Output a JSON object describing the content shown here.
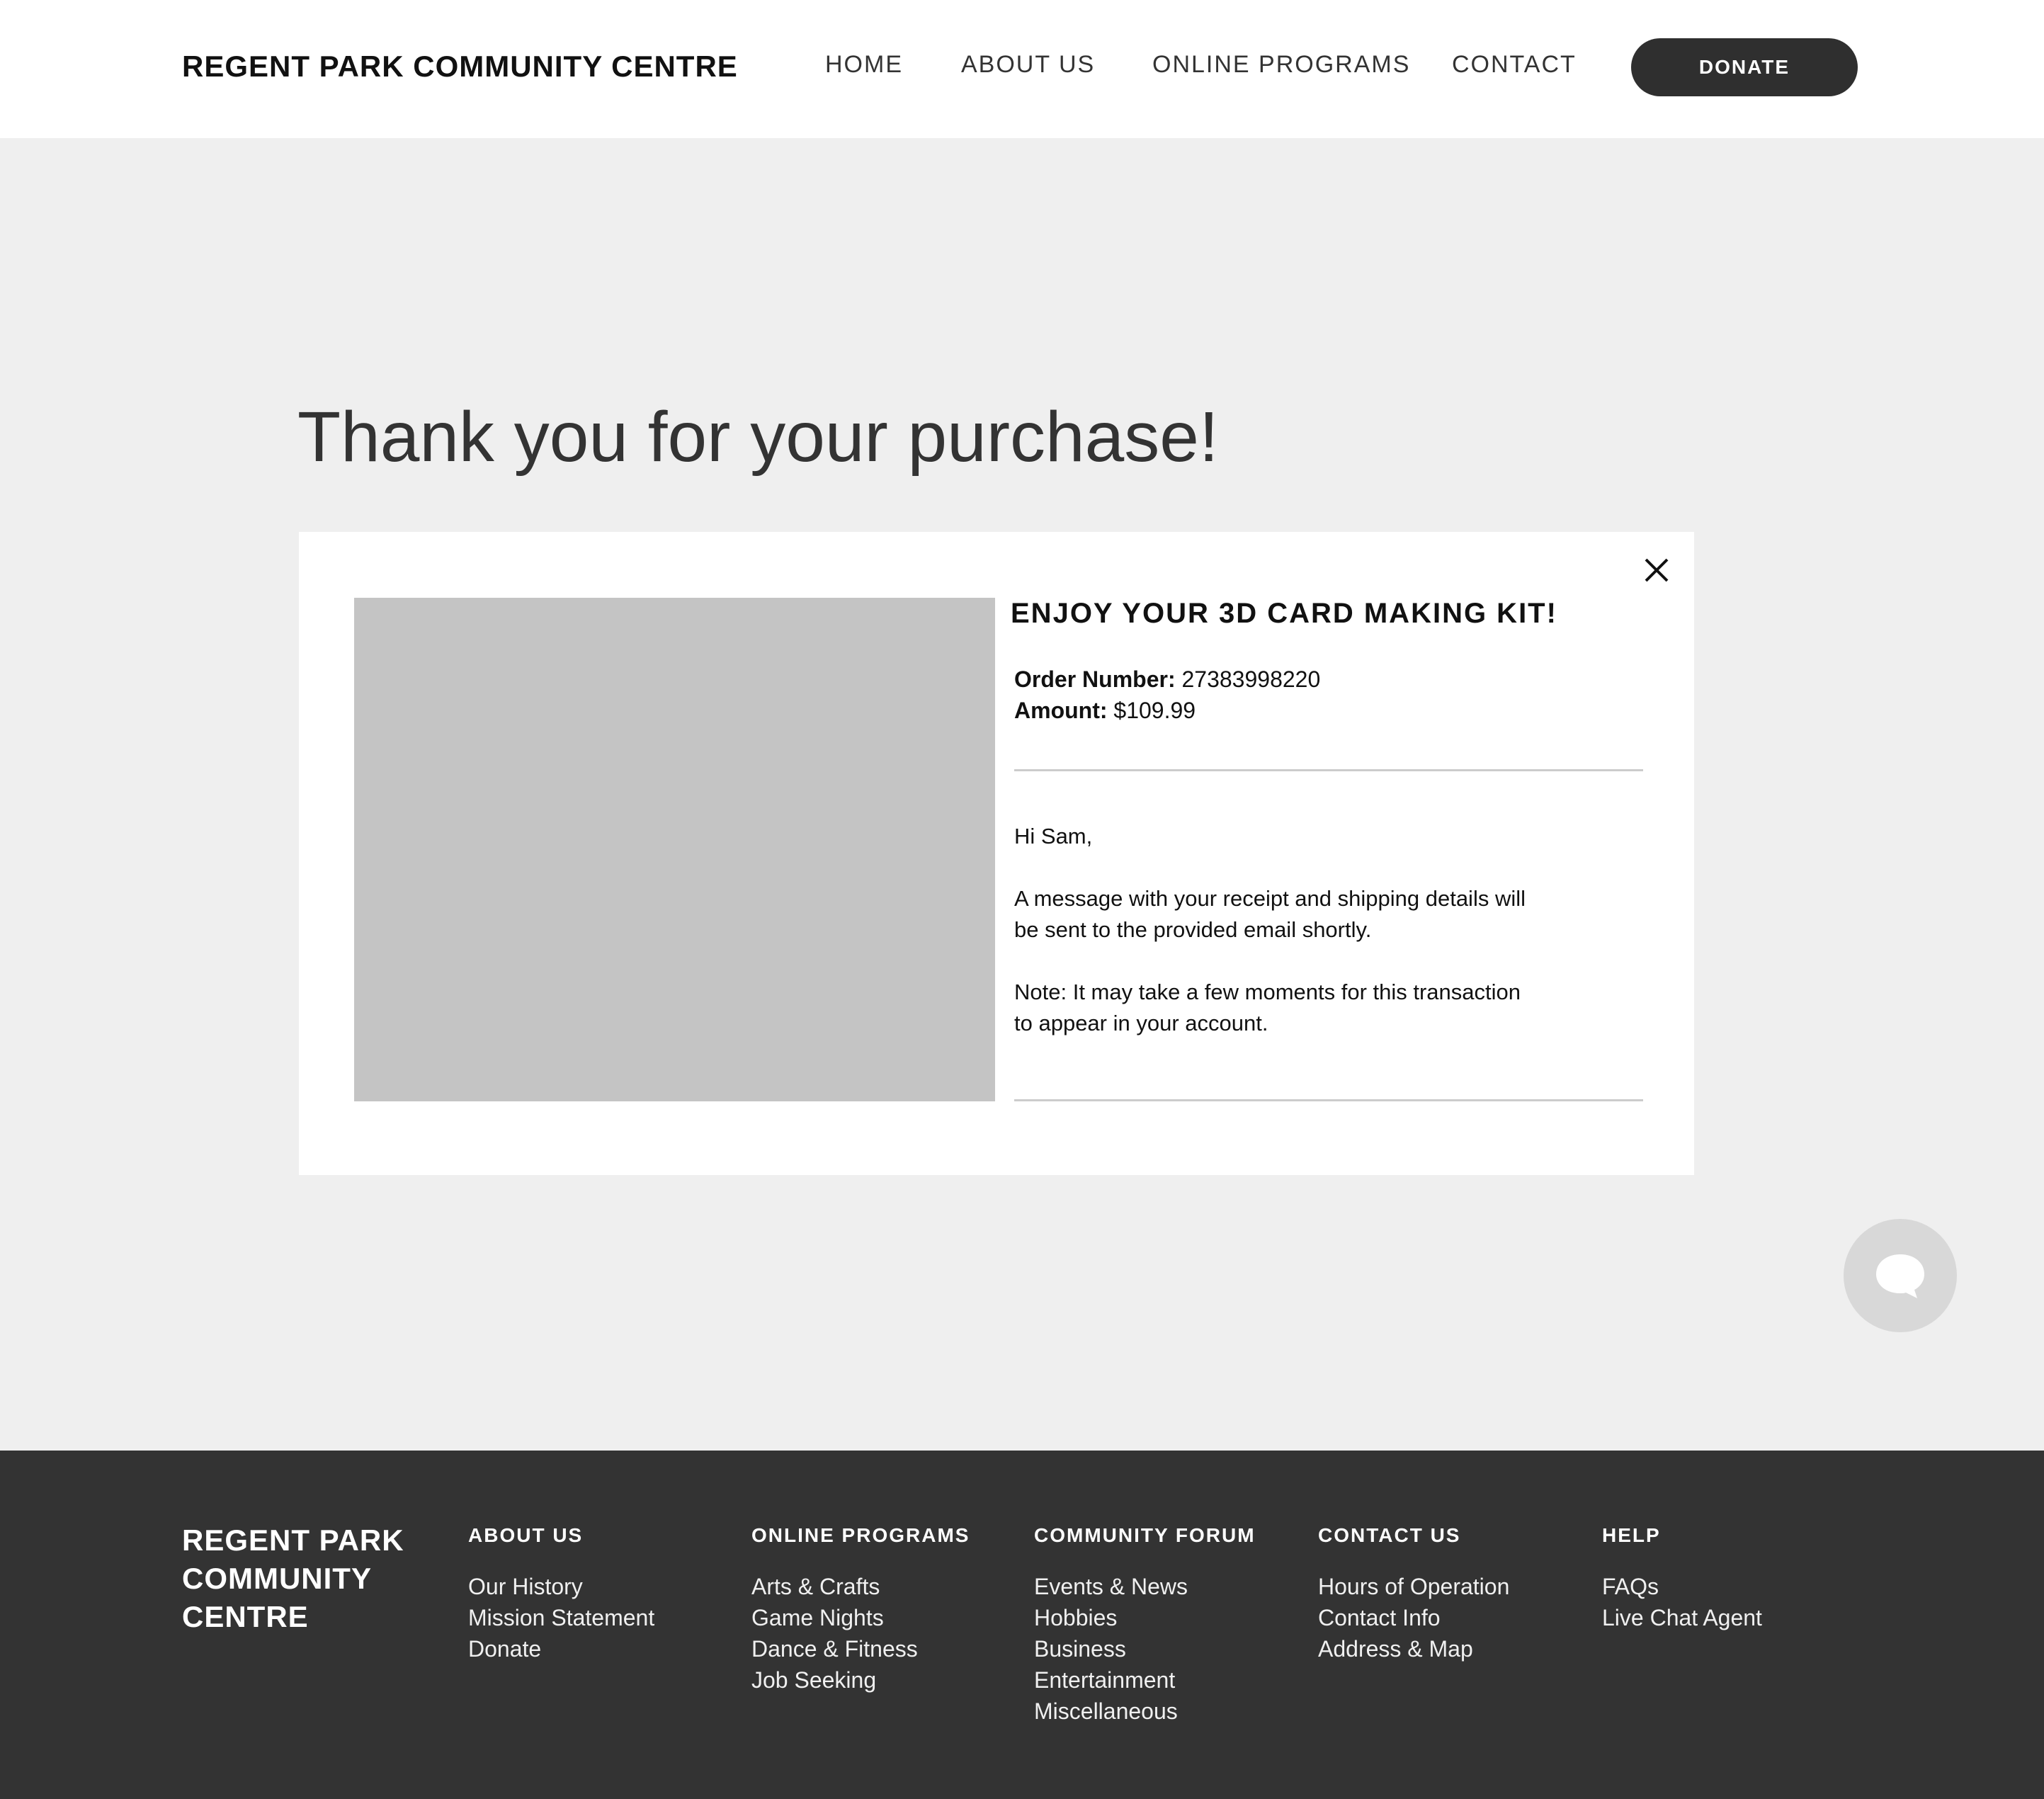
{
  "header": {
    "brand": "REGENT PARK COMMUNITY CENTRE",
    "nav": [
      "HOME",
      "ABOUT US",
      "ONLINE PROGRAMS",
      "CONTACT"
    ],
    "donate_label": "DONATE"
  },
  "main": {
    "title": "Thank you for your purchase!",
    "card": {
      "heading": "ENJOY YOUR 3D CARD MAKING KIT!",
      "order_label": "Order Number:",
      "order_value": "27383998220",
      "amount_label": "Amount:",
      "amount_value": "$109.99",
      "greeting": "Hi Sam,",
      "message_line1": "A message with your receipt and shipping details will",
      "message_line2": "be sent to the provided email shortly.",
      "note_line1": "Note: It may take a few moments for this transaction",
      "note_line2": "to appear in your account."
    }
  },
  "footer": {
    "brand_lines": [
      "REGENT PARK",
      "COMMUNITY",
      "CENTRE"
    ],
    "columns": [
      {
        "title": "ABOUT US",
        "links": [
          "Our History",
          "Mission Statement",
          "Donate"
        ]
      },
      {
        "title": "ONLINE PROGRAMS",
        "links": [
          "Arts & Crafts",
          "Game Nights",
          "Dance & Fitness",
          "Job Seeking"
        ]
      },
      {
        "title": "COMMUNITY FORUM",
        "links": [
          "Events & News",
          "Hobbies",
          "Business",
          "Entertainment",
          "Miscellaneous"
        ]
      },
      {
        "title": "CONTACT US",
        "links": [
          "Hours of Operation",
          "Contact Info",
          "Address & Map"
        ]
      },
      {
        "title": "HELP",
        "links": [
          "FAQs",
          "Live Chat Agent"
        ]
      }
    ]
  },
  "icons": {
    "close": "close-icon",
    "chat": "chat-bubble-icon"
  },
  "colors": {
    "page_bg": "#efefef",
    "header_bg": "#ffffff",
    "footer_bg": "#333333",
    "donate_bg": "#2f2f2f",
    "image_placeholder": "#c4c4c4",
    "chat_bg": "#d8d8d8"
  }
}
